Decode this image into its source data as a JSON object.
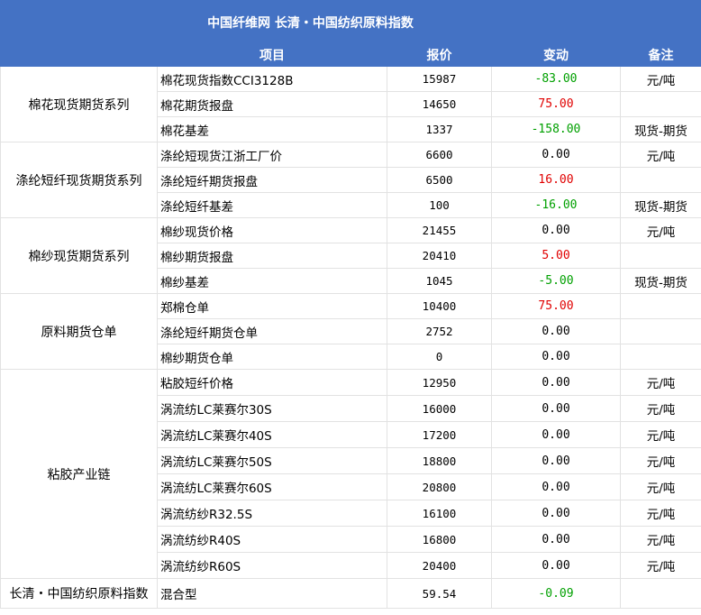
{
  "title": "中国纤维网 长清・中国纺织原料指数",
  "headers": {
    "item": "项目",
    "price": "报价",
    "change": "变动",
    "note": "备注"
  },
  "colors": {
    "header_bg": "#4472c4",
    "negative": "#00a000",
    "positive": "#e00000"
  },
  "groups": [
    {
      "name": "棉花现货期货系列",
      "rows": [
        {
          "item": "棉花现货指数CCI3128B",
          "price": "15987",
          "change": "-83.00",
          "note": "元/吨"
        },
        {
          "item": "棉花期货报盘",
          "price": "14650",
          "change": "75.00",
          "note": ""
        },
        {
          "item": "棉花基差",
          "price": "1337",
          "change": "-158.00",
          "note": "现货-期货"
        }
      ]
    },
    {
      "name": "涤纶短纤现货期货系列",
      "rows": [
        {
          "item": "涤纶短现货江浙工厂价",
          "price": "6600",
          "change": "0.00",
          "note": "元/吨"
        },
        {
          "item": "涤纶短纤期货报盘",
          "price": "6500",
          "change": "16.00",
          "note": ""
        },
        {
          "item": "涤纶短纤基差",
          "price": "100",
          "change": "-16.00",
          "note": "现货-期货"
        }
      ]
    },
    {
      "name": "棉纱现货期货系列",
      "rows": [
        {
          "item": "棉纱现货价格",
          "price": "21455",
          "change": "0.00",
          "note": "元/吨"
        },
        {
          "item": "棉纱期货报盘",
          "price": "20410",
          "change": "5.00",
          "note": ""
        },
        {
          "item": "棉纱基差",
          "price": "1045",
          "change": "-5.00",
          "note": "现货-期货"
        }
      ]
    },
    {
      "name": "原料期货仓单",
      "rows": [
        {
          "item": "郑棉仓单",
          "price": "10400",
          "change": "75.00",
          "note": ""
        },
        {
          "item": "涤纶短纤期货仓单",
          "price": "2752",
          "change": "0.00",
          "note": ""
        },
        {
          "item": "棉纱期货仓单",
          "price": "0",
          "change": "0.00",
          "note": ""
        }
      ]
    },
    {
      "name": "粘胶产业链",
      "rows": [
        {
          "item": "粘胶短纤价格",
          "price": "12950",
          "change": "0.00",
          "note": "元/吨"
        },
        {
          "item": "涡流纺LC莱赛尔30S",
          "price": "16000",
          "change": "0.00",
          "note": "元/吨"
        },
        {
          "item": "涡流纺LC莱赛尔40S",
          "price": "17200",
          "change": "0.00",
          "note": "元/吨"
        },
        {
          "item": "涡流纺LC莱赛尔50S",
          "price": "18800",
          "change": "0.00",
          "note": "元/吨"
        },
        {
          "item": "涡流纺LC莱赛尔60S",
          "price": "20800",
          "change": "0.00",
          "note": "元/吨"
        },
        {
          "item": "涡流纺纱R32.5S",
          "price": "16100",
          "change": "0.00",
          "note": "元/吨"
        },
        {
          "item": "涡流纺纱R40S",
          "price": "16800",
          "change": "0.00",
          "note": "元/吨"
        },
        {
          "item": "涡流纺纱R60S",
          "price": "20400",
          "change": "0.00",
          "note": "元/吨"
        }
      ]
    }
  ],
  "footer": {
    "name": "长清・中国纺织原料指数",
    "item": "混合型",
    "price": "59.54",
    "change": "-0.09",
    "note": ""
  }
}
